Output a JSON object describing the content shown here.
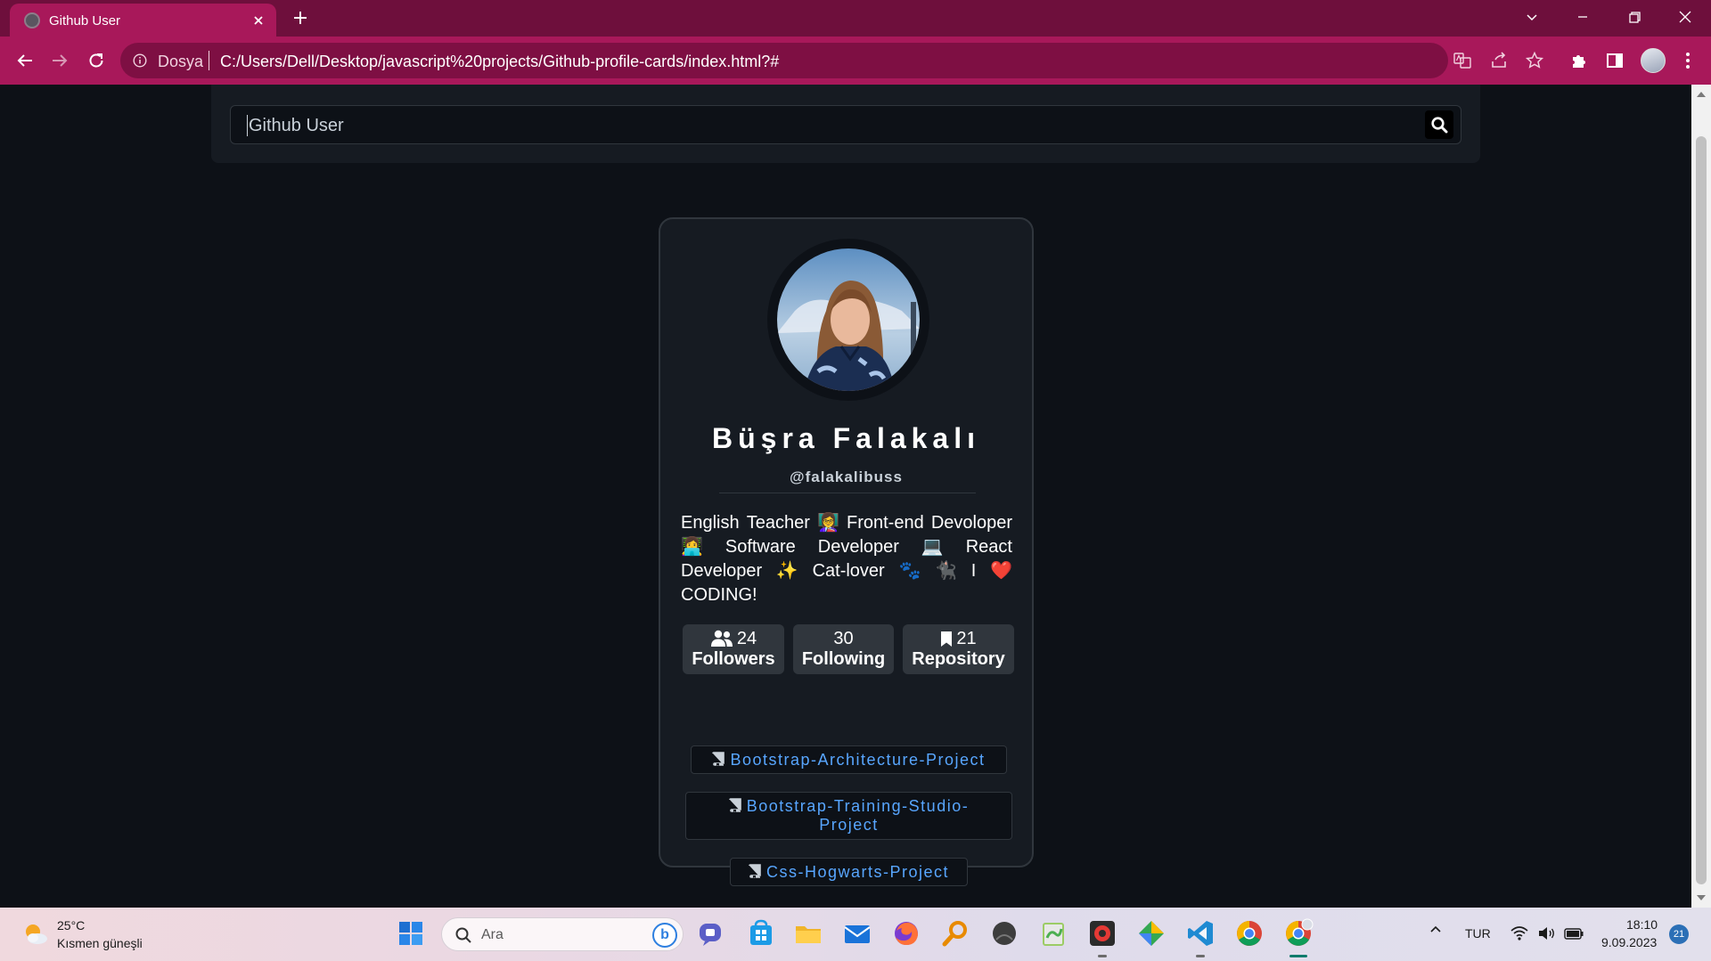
{
  "browser": {
    "tab_title": "Github User",
    "omnibox_label": "Dosya",
    "url": "C:/Users/Dell/Desktop/javascript%20projects/Github-profile-cards/index.html?#"
  },
  "search": {
    "placeholder": "Github User"
  },
  "profile": {
    "name": "Büşra Falakalı",
    "login": "@falakalibuss",
    "bio_lines": [
      [
        "English",
        "Teacher",
        "👩‍🏫",
        "Front-end",
        "Devoloper"
      ],
      [
        "👩‍💻",
        "Software",
        "Developer",
        "💻",
        "React"
      ],
      [
        "Developer",
        "✨",
        "Cat-lover",
        "🐾",
        "🐈‍⬛",
        "I",
        "❤️"
      ],
      [
        "CODING!"
      ]
    ],
    "stats": {
      "followers": {
        "count": "24",
        "label": "Followers"
      },
      "following": {
        "count": "30",
        "label": "Following"
      },
      "repository": {
        "count": "21",
        "label": "Repository"
      }
    },
    "repos": [
      {
        "name": "Bootstrap-Architecture-Project"
      },
      {
        "name": "Bootstrap-Training-Studio-Project",
        "line1": "Bootstrap-Training-Studio-",
        "line2": "Project"
      },
      {
        "name": "Css-Hogwarts-Project"
      }
    ]
  },
  "taskbar": {
    "weather_temp": "25°C",
    "weather_desc": "Kısmen güneşli",
    "search_placeholder": "Ara",
    "language": "TUR",
    "time": "18:10",
    "date": "9.09.2023",
    "notification_count": "21"
  },
  "colors": {
    "chrome_tab_strip": "#6e0f3c",
    "chrome_toolbar": "#a8185a",
    "page_bg": "#0d1117",
    "card_bg": "#161b22",
    "link": "#58a6ff"
  }
}
